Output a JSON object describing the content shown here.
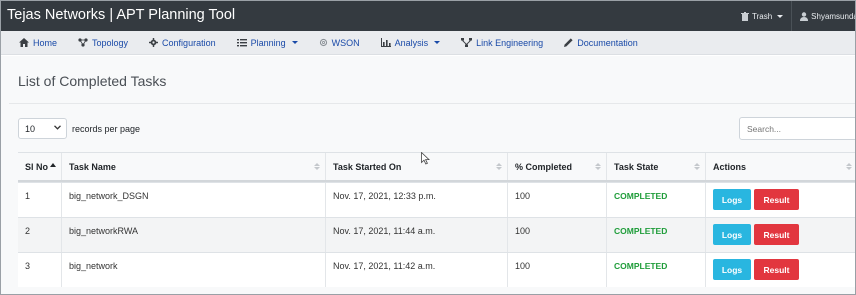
{
  "app": {
    "title": "Tejas Networks | APT Planning Tool",
    "trash_label": "Trash",
    "user_label": "Shyamsundar"
  },
  "nav": {
    "items": [
      {
        "label": "Home",
        "icon": "home-icon"
      },
      {
        "label": "Topology",
        "icon": "topology-icon"
      },
      {
        "label": "Configuration",
        "icon": "gear-icon"
      },
      {
        "label": "Planning",
        "icon": "list-icon"
      },
      {
        "label": "WSON",
        "icon": "gear-outline-icon"
      },
      {
        "label": "Analysis",
        "icon": "bar-chart-icon"
      },
      {
        "label": "Link Engineering",
        "icon": "sitemap-icon"
      },
      {
        "label": "Documentation",
        "icon": "pencil-icon"
      }
    ]
  },
  "page": {
    "title": "List of Completed Tasks",
    "length_value": "10",
    "length_label": "records per page",
    "search_placeholder": "Search..."
  },
  "table": {
    "headers": [
      "Sl No",
      "Task Name",
      "Task Started On",
      "% Completed",
      "Task State",
      "Actions"
    ],
    "rows": [
      {
        "sl": "1",
        "name": "big_network_DSGN",
        "started": "Nov. 17, 2021, 12:33 p.m.",
        "pct": "100",
        "state": "COMPLETED"
      },
      {
        "sl": "2",
        "name": "big_networkRWA",
        "started": "Nov. 17, 2021, 11:44 a.m.",
        "pct": "100",
        "state": "COMPLETED"
      },
      {
        "sl": "3",
        "name": "big_network",
        "started": "Nov. 17, 2021, 11:42 a.m.",
        "pct": "100",
        "state": "COMPLETED"
      }
    ],
    "logs_label": "Logs",
    "result_label": "Result"
  },
  "colors": {
    "topbar": "#343a40",
    "nav_link": "#1a4aa8",
    "completed": "#1f9d3a",
    "logs_button": "#29b6e0",
    "result_button": "#e2363f"
  }
}
